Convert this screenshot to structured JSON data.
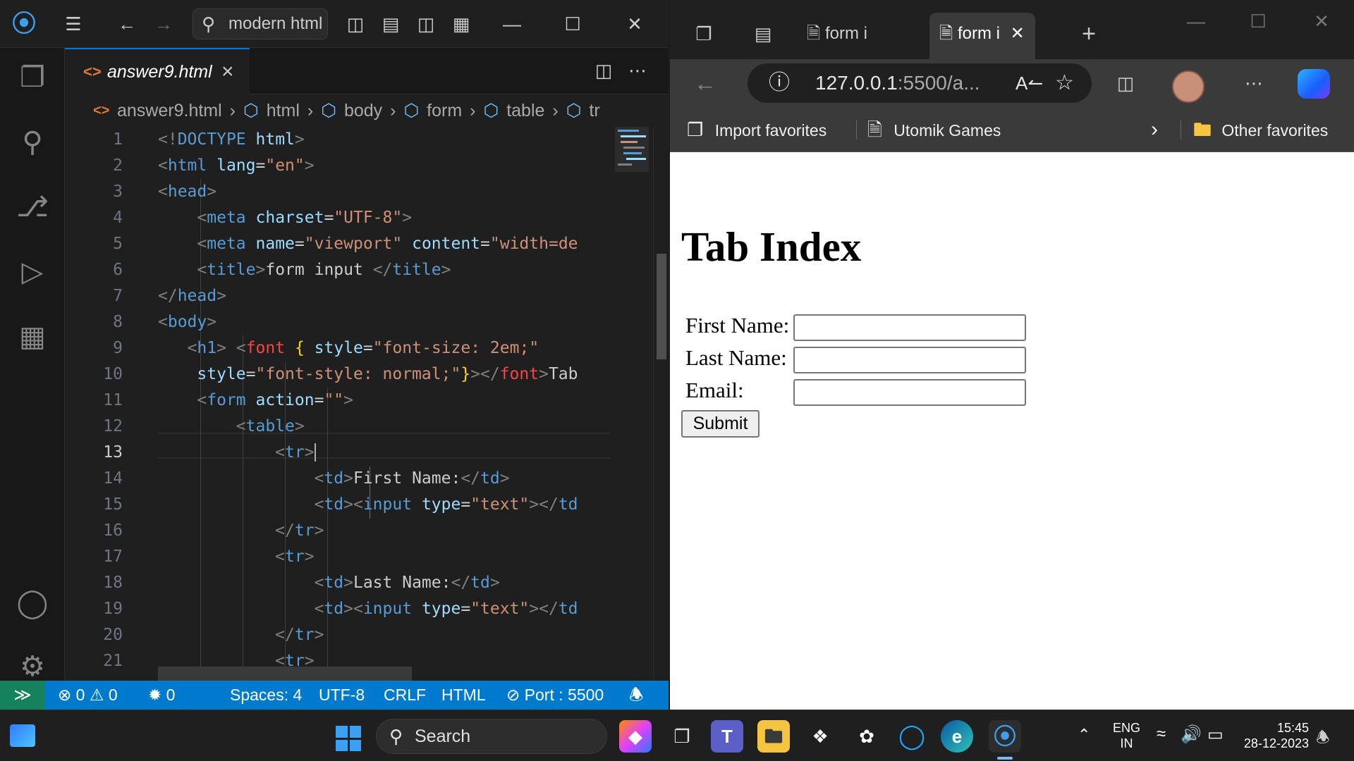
{
  "vscode": {
    "search_text": "modern html",
    "tab_filename": "answer9.html",
    "breadcrumb": [
      "answer9.html",
      "html",
      "body",
      "form",
      "table",
      "tr"
    ],
    "line_numbers": [
      "1",
      "2",
      "3",
      "4",
      "5",
      "6",
      "7",
      "8",
      "9",
      "10",
      "11",
      "12",
      "13",
      "14",
      "15",
      "16",
      "17",
      "18",
      "19",
      "20",
      "21"
    ],
    "current_line": "13",
    "status": {
      "errors": "0",
      "warnings": "0",
      "ports": "0",
      "spaces": "Spaces: 4",
      "encoding": "UTF-8",
      "eol": "CRLF",
      "language": "HTML",
      "port": "Port : 5500"
    }
  },
  "browser": {
    "tab1_title": "form i",
    "tab2_title": "form i",
    "url_host": "127.0.0.1",
    "url_rest": ":5500/a...",
    "bookmarks": {
      "import": "Import favorites",
      "utomik": "Utomik Games",
      "other": "Other favorites"
    },
    "page": {
      "heading": "Tab Index",
      "first_name_label": "First Name:",
      "last_name_label": "Last Name:",
      "email_label": "Email:",
      "submit_label": "Submit"
    }
  },
  "taskbar": {
    "search_label": "Search",
    "lang_top": "ENG",
    "lang_bottom": "IN",
    "time": "15:45",
    "date": "28-12-2023"
  }
}
